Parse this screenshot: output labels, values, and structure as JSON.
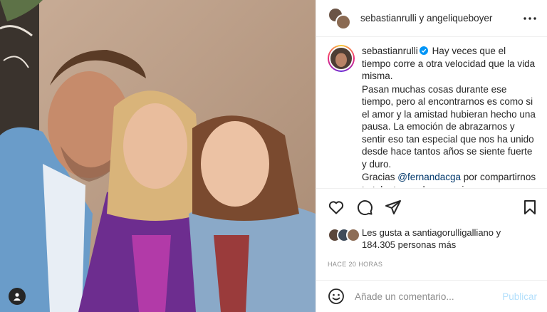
{
  "header": {
    "title": "sebastianrulli y angeliqueboyer",
    "more_icon": "more-horizontal-icon"
  },
  "caption": {
    "username": "sebastianrulli",
    "verified_icon": "verified-badge-icon",
    "line1": "Hay veces que el tiempo corre a otra velocidad que la vida misma.",
    "line2": "Pasan muchas cosas durante ese tiempo, pero al encontrarnos es como si el amor y la amistad hubieran hecho una pausa. La emoción de abrazarnos y sentir eso tan especial que nos ha unido desde hace tantos años se siente fuerte y duro.",
    "line3_prefix": "Gracias ",
    "mention": "@fernandacga",
    "line3_suffix": " por compartirnos tu talento en el escenario"
  },
  "actions": {
    "like_icon": "heart-icon",
    "comment_icon": "comment-icon",
    "share_icon": "send-icon",
    "save_icon": "bookmark-icon"
  },
  "likes": {
    "line1": "Les gusta a santiagorulligalliano y",
    "line2": "184.305 personas más"
  },
  "timestamp": "HACE 20 HORAS",
  "comment": {
    "emoji_icon": "emoji-icon",
    "placeholder": "Añade un comentario...",
    "publish_label": "Publicar"
  },
  "colors": {
    "accent": "#0095f6",
    "publish_disabled": "#b2dffc",
    "mention": "#00376b",
    "secondary_text": "#8e8e8e"
  }
}
